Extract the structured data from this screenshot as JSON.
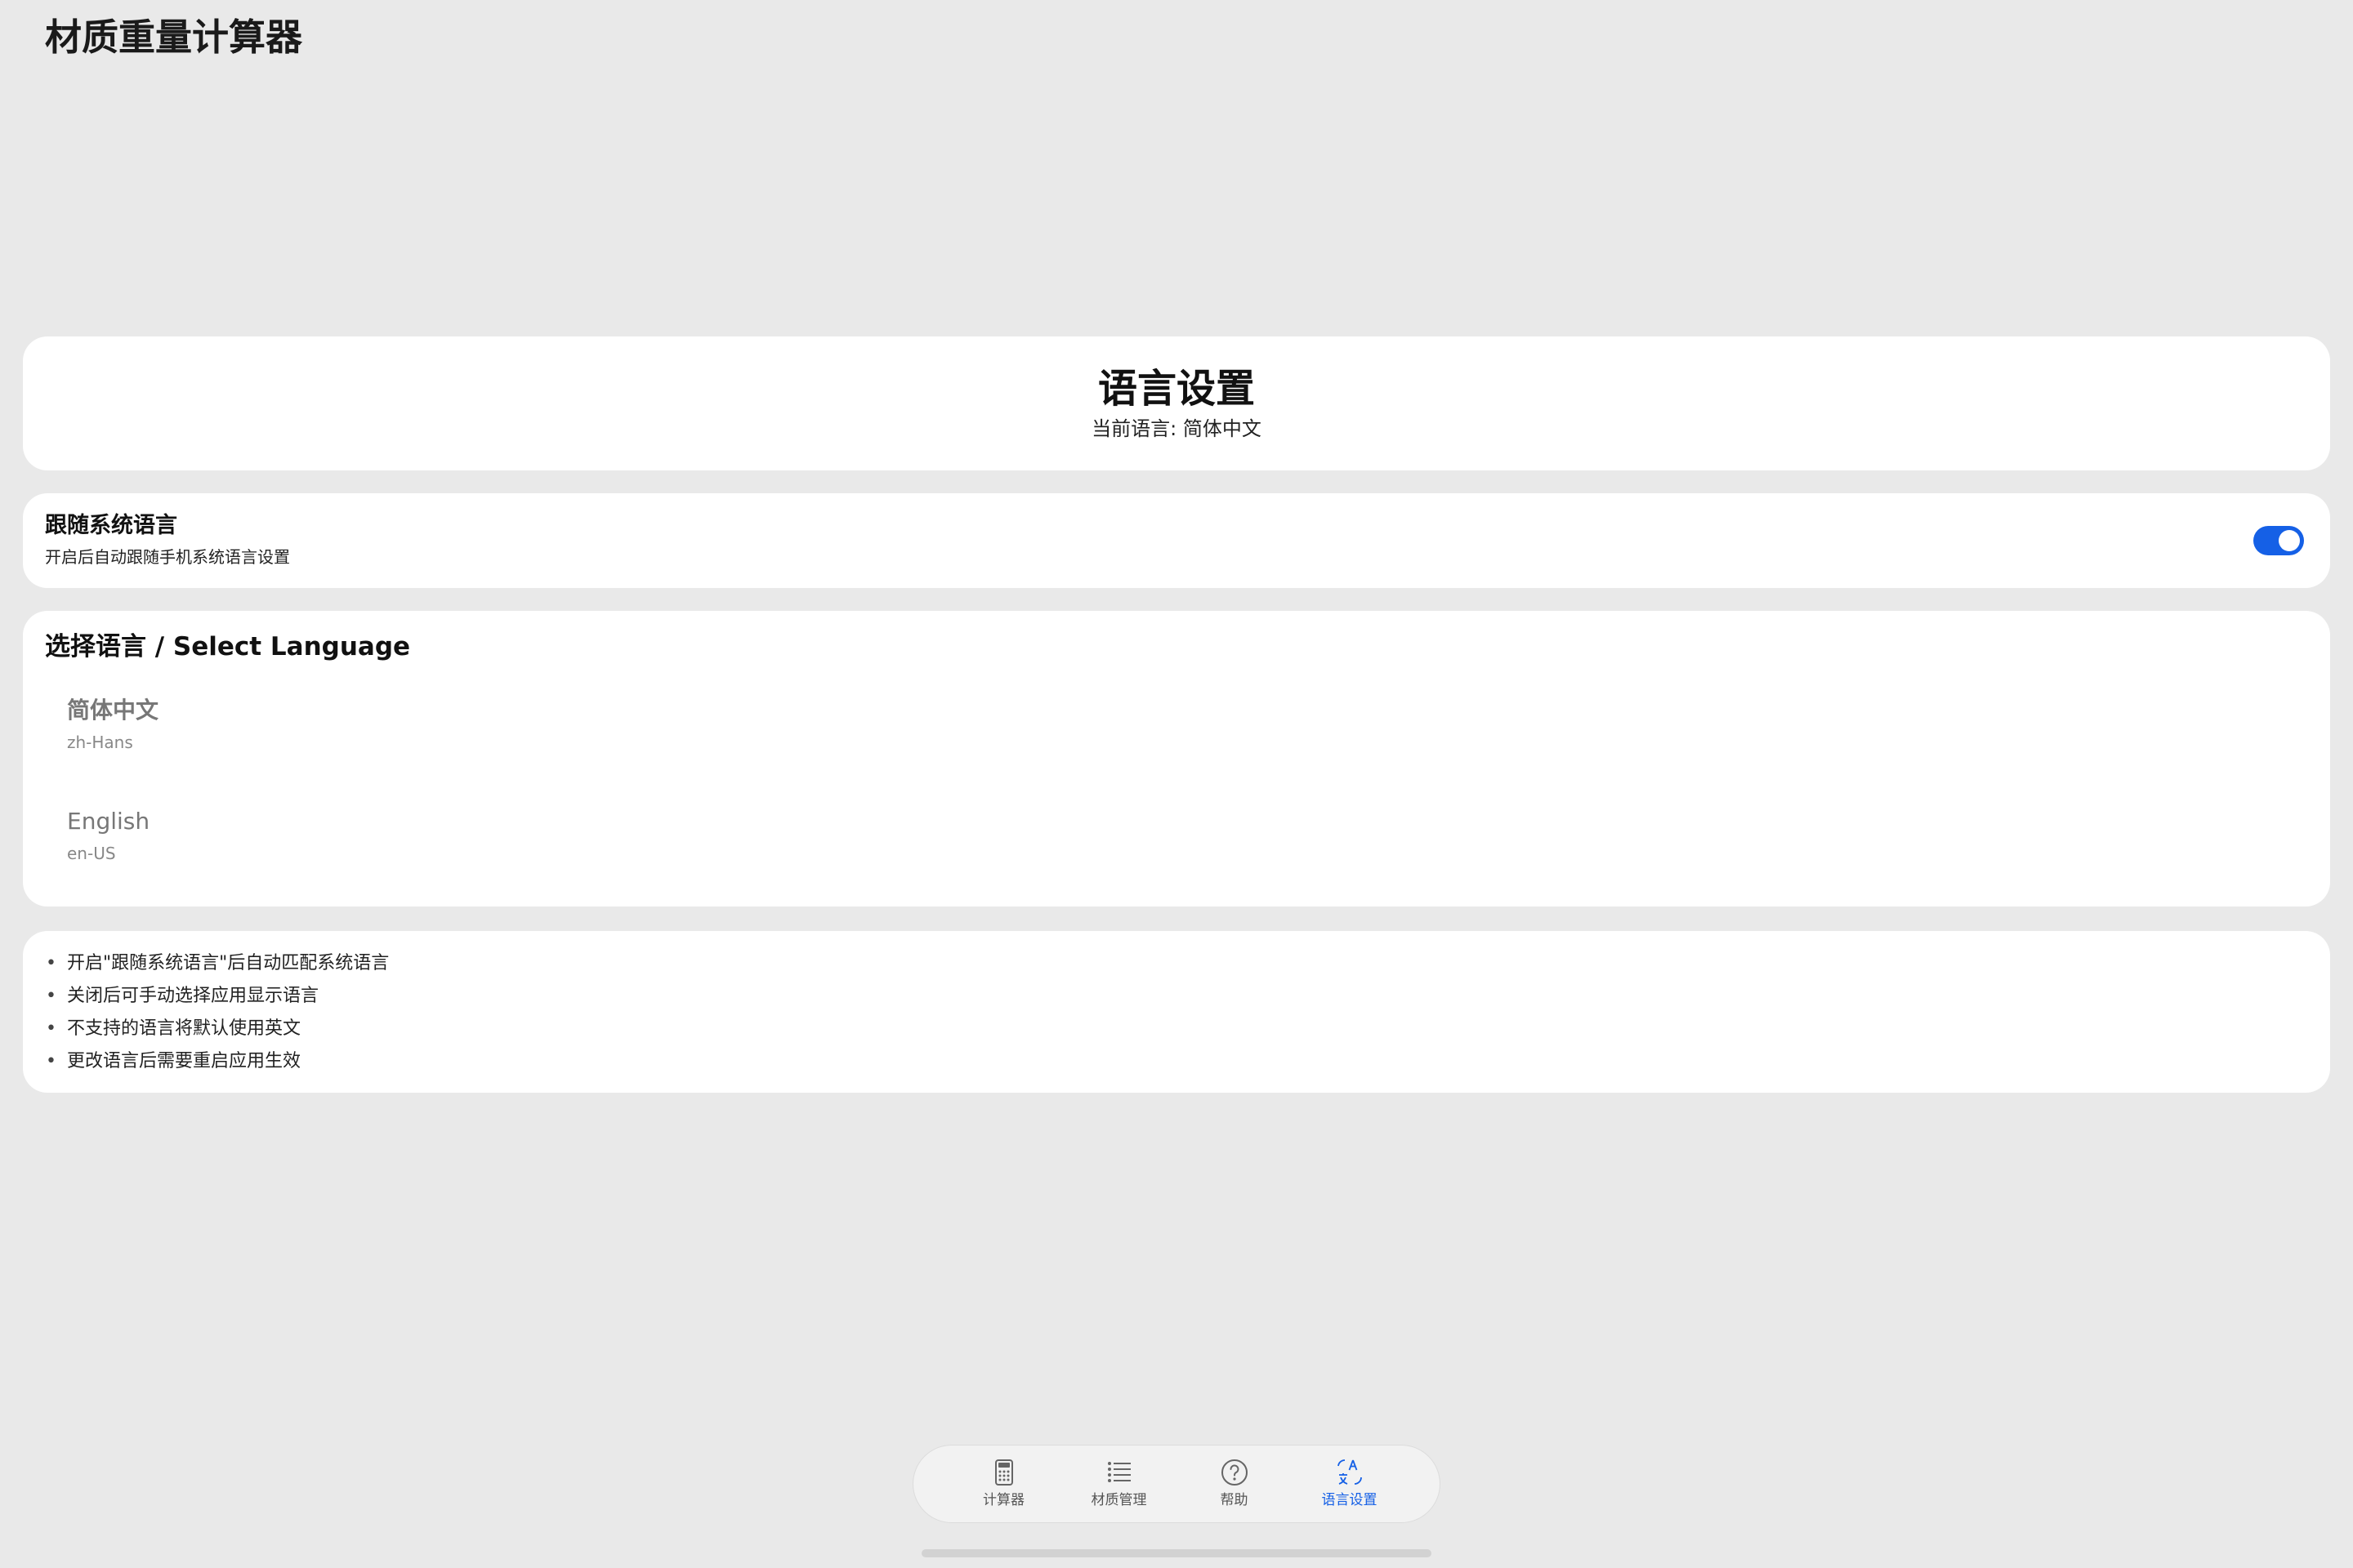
{
  "app": {
    "title": "材质重量计算器"
  },
  "header_card": {
    "title": "语言设置",
    "current_language": "当前语言: 简体中文"
  },
  "follow_system": {
    "title": "跟随系统语言",
    "description": "开启后自动跟随手机系统语言设置",
    "enabled": true,
    "accent_color": "#1560e6"
  },
  "language_select": {
    "title": "选择语言 / Select Language",
    "options": [
      {
        "name": "简体中文",
        "code": "zh-Hans"
      },
      {
        "name": "English",
        "code": "en-US"
      }
    ]
  },
  "tips": [
    "开启\"跟随系统语言\"后自动匹配系统语言",
    "关闭后可手动选择应用显示语言",
    "不支持的语言将默认使用英文",
    "更改语言后需要重启应用生效"
  ],
  "tip_bullet": "•",
  "tabbar": {
    "tabs": [
      {
        "label": "计算器",
        "icon": "calculator-icon"
      },
      {
        "label": "材质管理",
        "icon": "list-icon"
      },
      {
        "label": "帮助",
        "icon": "help-icon"
      },
      {
        "label": "语言设置",
        "icon": "translate-icon",
        "active": true
      }
    ]
  }
}
